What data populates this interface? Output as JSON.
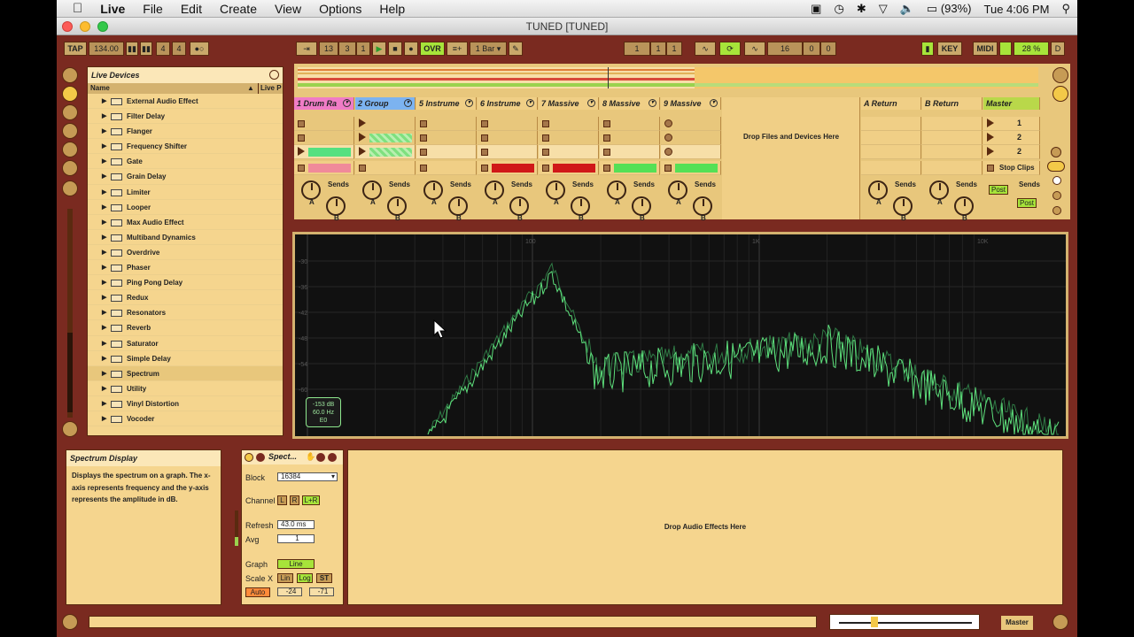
{
  "menubar": {
    "apple": "",
    "app": "Live",
    "items": [
      "File",
      "Edit",
      "Create",
      "View",
      "Options",
      "Help"
    ],
    "battery": "(93%)",
    "clock": "Tue 4:06 PM"
  },
  "window": {
    "title": "TUNED  [TUNED]"
  },
  "transport": {
    "tap": "TAP",
    "tempo": "134.00",
    "sig_num": "4",
    "sig_den": "4",
    "position": [
      "13",
      "3",
      "1"
    ],
    "ovr": "OVR",
    "quant": "1 Bar",
    "loop_start": [
      "1",
      "1",
      "1"
    ],
    "loop_len": [
      "16",
      "0",
      "0"
    ],
    "key": "KEY",
    "midi": "MIDI",
    "cpu": "28 %",
    "d": "D"
  },
  "browser": {
    "title": "Live Devices",
    "col_name": "Name",
    "col_live": "Live P",
    "items": [
      "External Audio Effect",
      "Filter Delay",
      "Flanger",
      "Frequency Shifter",
      "Gate",
      "Grain Delay",
      "Limiter",
      "Looper",
      "Max Audio Effect",
      "Multiband Dynamics",
      "Overdrive",
      "Phaser",
      "Ping Pong Delay",
      "Redux",
      "Resonators",
      "Reverb",
      "Saturator",
      "Simple Delay",
      "Spectrum",
      "Utility",
      "Vinyl Distortion",
      "Vocoder"
    ],
    "selected": "Spectrum"
  },
  "session": {
    "tracks": [
      {
        "name": "1 Drum Ra",
        "color": "#f07cc6"
      },
      {
        "name": "2 Group",
        "color": "#7cb3f0"
      },
      {
        "name": "5 Instrume",
        "color": "#f0cf86"
      },
      {
        "name": "6 Instrume",
        "color": "#f0cf86"
      },
      {
        "name": "7 Massive",
        "color": "#f0cf86"
      },
      {
        "name": "8  Massive",
        "color": "#f0cf86"
      },
      {
        "name": "9  Massive",
        "color": "#f0cf86"
      }
    ],
    "drop_text": "Drop Files and Devices Here",
    "returns": [
      "A Return",
      "B Return"
    ],
    "master": "Master",
    "scenes": [
      "1",
      "2",
      "2"
    ],
    "stop_clips": "Stop Clips",
    "sends": "Sends",
    "knob_a": "A",
    "knob_b": "B",
    "post": "Post"
  },
  "spectrum": {
    "freq_labels": [
      "100",
      "1K",
      "10K"
    ],
    "db_labels": [
      "-30",
      "-36",
      "-42",
      "-48",
      "-54",
      "-60"
    ],
    "readout": [
      "-153 dB",
      "60.0 Hz",
      "E0"
    ]
  },
  "info": {
    "title": "Spectrum Display",
    "body": "Displays the spectrum on a graph. The x-axis represents frequency and the y-axis represents the amplitude in dB."
  },
  "device": {
    "name": "Spect...",
    "block_label": "Block",
    "block_value": "16384",
    "channel_label": "Channel",
    "ch_l": "L",
    "ch_r": "R",
    "ch_lr": "L+R",
    "refresh_label": "Refresh",
    "refresh_value": "43.0 ms",
    "avg_label": "Avg",
    "avg_value": "1",
    "graph_label": "Graph",
    "graph_value": "Line",
    "scalex_label": "Scale X",
    "lin": "Lin",
    "log": "Log",
    "st": "ST",
    "auto": "Auto",
    "range_lo": "-24",
    "range_hi": "-71"
  },
  "drop_effects": "Drop Audio Effects Here",
  "status": {
    "master": "Master"
  }
}
